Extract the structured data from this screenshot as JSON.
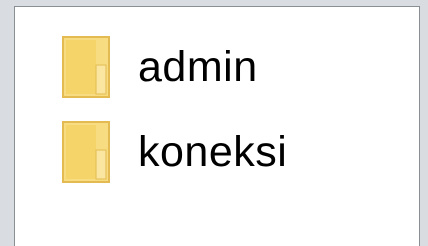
{
  "file_list": {
    "items": [
      {
        "name": "admin",
        "type": "folder",
        "icon": "folder-icon"
      },
      {
        "name": "koneksi",
        "type": "folder",
        "icon": "folder-icon"
      }
    ]
  },
  "colors": {
    "folder_fill": "#f5d97a",
    "folder_edge": "#e0b84a",
    "background": "#ffffff",
    "frame": "#d9dde2"
  }
}
